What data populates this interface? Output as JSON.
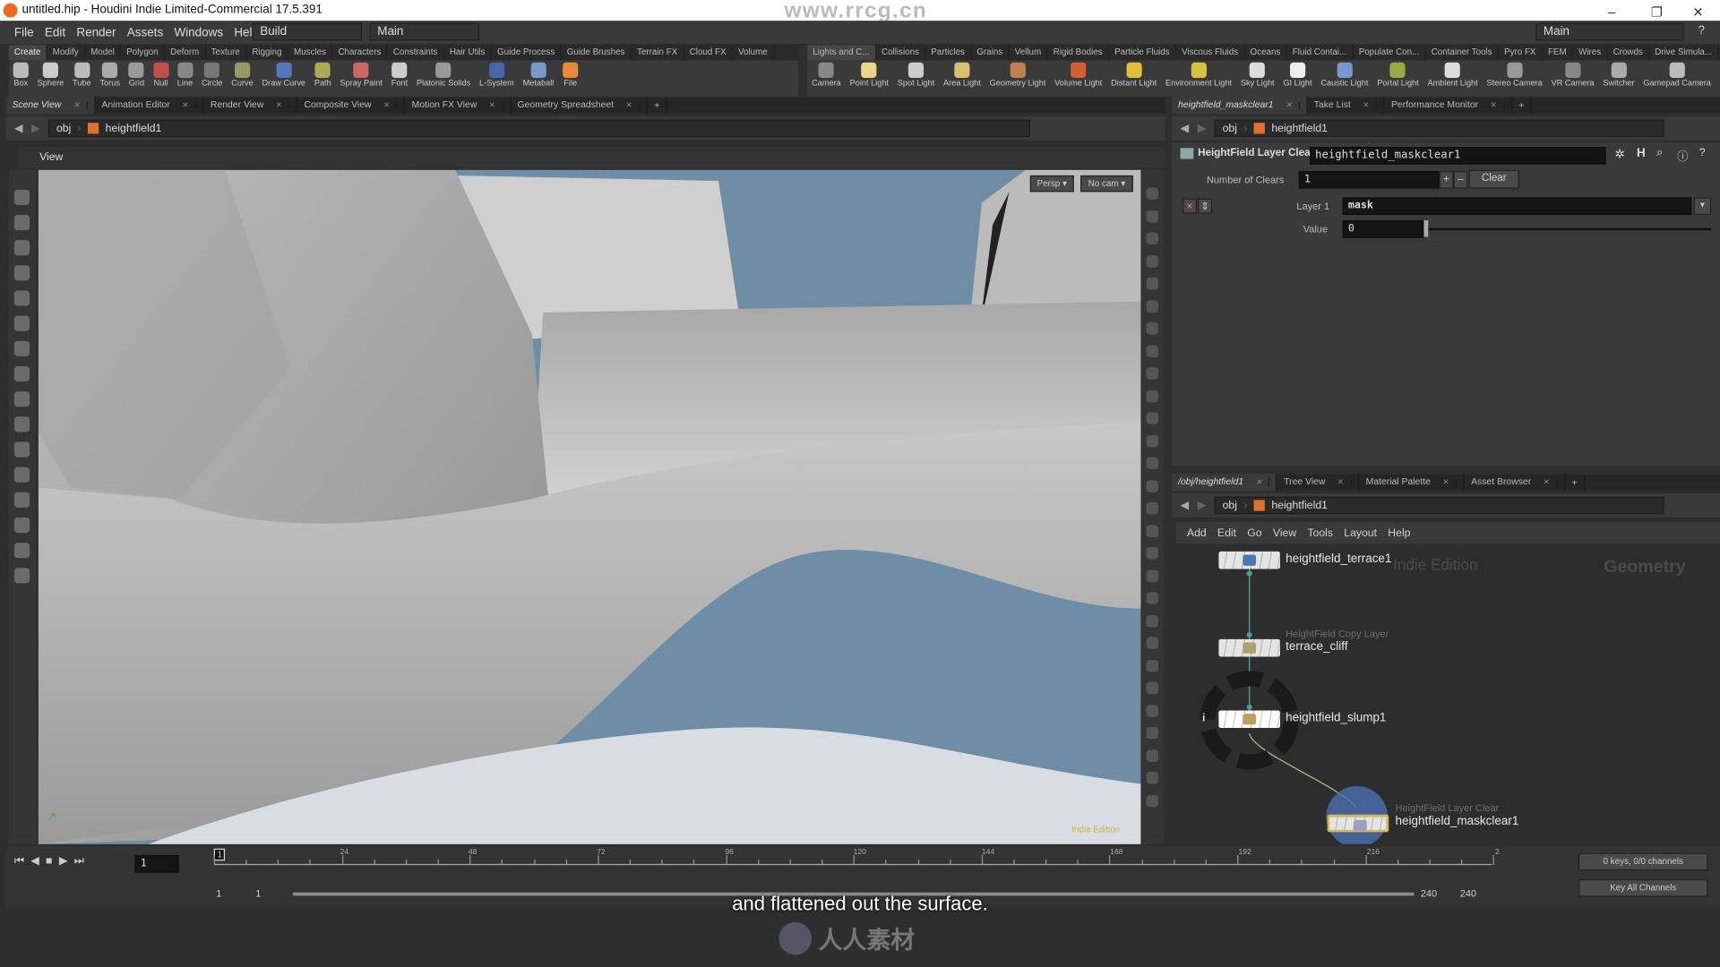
{
  "window": {
    "title": "untitled.hip - Houdini Indie Limited-Commercial 17.5.391",
    "watermark": "www.rrcg.cn",
    "minimize": "–",
    "maximize": "❐",
    "close": "✕"
  },
  "menubar": {
    "items": [
      "File",
      "Edit",
      "Render",
      "Assets",
      "Windows",
      "Help"
    ],
    "desktop": "Build",
    "context": "Main",
    "right_desktop": "Main",
    "help": "?"
  },
  "shelf_left": {
    "tabs": [
      "Create",
      "Modify",
      "Model",
      "Polygon",
      "Deform",
      "Texture",
      "Rigging",
      "Muscles",
      "Characters",
      "Constraints",
      "Hair Utils",
      "Guide Process",
      "Guide Brushes",
      "Terrain FX",
      "Cloud FX",
      "Volume"
    ],
    "tools": [
      {
        "label": "Box",
        "icon": "box-icon",
        "color": "#bbbbbb"
      },
      {
        "label": "Sphere",
        "icon": "sphere-icon",
        "color": "#cccccc"
      },
      {
        "label": "Tube",
        "icon": "tube-icon",
        "color": "#bbbbbb"
      },
      {
        "label": "Torus",
        "icon": "torus-icon",
        "color": "#aaaaaa"
      },
      {
        "label": "Grid",
        "icon": "grid-icon",
        "color": "#999999"
      },
      {
        "label": "Null",
        "icon": "null-icon",
        "color": "#c0504d"
      },
      {
        "label": "Line",
        "icon": "line-icon",
        "color": "#888888"
      },
      {
        "label": "Circle",
        "icon": "circle-icon",
        "color": "#777777"
      },
      {
        "label": "Curve",
        "icon": "curve-icon",
        "color": "#999966"
      },
      {
        "label": "Draw Curve",
        "icon": "draw-curve-icon",
        "color": "#5577bb"
      },
      {
        "label": "Path",
        "icon": "path-icon",
        "color": "#aaaa55"
      },
      {
        "label": "Spray Paint",
        "icon": "spray-paint-icon",
        "color": "#cc6666"
      },
      {
        "label": "Font",
        "icon": "font-icon",
        "color": "#cccccc"
      },
      {
        "label": "Platonic Solids",
        "icon": "platonic-solids-icon",
        "color": "#999999"
      },
      {
        "label": "L-System",
        "icon": "l-system-icon",
        "color": "#4466aa"
      },
      {
        "label": "Metaball",
        "icon": "metaball-icon",
        "color": "#7799cc"
      },
      {
        "label": "File",
        "icon": "file-icon",
        "color": "#e88a3a"
      }
    ]
  },
  "shelf_right": {
    "tabs": [
      "Lights and C...",
      "Collisions",
      "Particles",
      "Grains",
      "Vellum",
      "Rigid Bodies",
      "Particle Fluids",
      "Viscous Fluids",
      "Oceans",
      "Fluid Contai...",
      "Populate Con...",
      "Container Tools",
      "Pyro FX",
      "FEM",
      "Wires",
      "Crowds",
      "Drive Simula..."
    ],
    "tools": [
      {
        "label": "Camera",
        "icon": "camera-icon",
        "color": "#888888"
      },
      {
        "label": "Point Light",
        "icon": "point-light-icon",
        "color": "#e8d58a"
      },
      {
        "label": "Spot Light",
        "icon": "spot-light-icon",
        "color": "#cccccc"
      },
      {
        "label": "Area Light",
        "icon": "area-light-icon",
        "color": "#d8c070"
      },
      {
        "label": "Geometry Light",
        "icon": "geometry-light-icon",
        "color": "#c08050"
      },
      {
        "label": "Volume Light",
        "icon": "volume-light-icon",
        "color": "#d06030"
      },
      {
        "label": "Distant Light",
        "icon": "distant-light-icon",
        "color": "#e0c040"
      },
      {
        "label": "Environment Light",
        "icon": "environment-light-icon",
        "color": "#d8c040"
      },
      {
        "label": "Sky Light",
        "icon": "sky-light-icon",
        "color": "#dddddd"
      },
      {
        "label": "GI Light",
        "icon": "gi-light-icon",
        "color": "#eeeeee"
      },
      {
        "label": "Caustic Light",
        "icon": "caustic-light-icon",
        "color": "#7799cc"
      },
      {
        "label": "Portal Light",
        "icon": "portal-light-icon",
        "color": "#99aa44"
      },
      {
        "label": "Ambient Light",
        "icon": "ambient-light-icon",
        "color": "#dddddd"
      },
      {
        "label": "Stereo Camera",
        "icon": "stereo-camera-icon",
        "color": "#999999"
      },
      {
        "label": "VR Camera",
        "icon": "vr-camera-icon",
        "color": "#888888"
      },
      {
        "label": "Switcher",
        "icon": "switcher-icon",
        "color": "#aaaaaa"
      },
      {
        "label": "Gamepad Camera",
        "icon": "gamepad-camera-icon",
        "color": "#bbbbbb"
      }
    ]
  },
  "left_pane": {
    "tabs": [
      "Scene View",
      "Animation Editor",
      "Render View",
      "Composite View",
      "Motion FX View",
      "Geometry Spreadsheet"
    ],
    "path": [
      "obj",
      "heightfield1"
    ],
    "view_label": "View",
    "persp": "Persp ▾",
    "cam": "No cam ▾",
    "edition": "Indie Edition"
  },
  "params_pane": {
    "tabs": [
      "heightfield_maskclear1",
      "Take List",
      "Performance Monitor"
    ],
    "path": [
      "obj",
      "heightfield1"
    ],
    "node_type": "HeightField Layer Clear",
    "node_name": "heightfield_maskclear1",
    "num_clears_label": "Number of Clears",
    "num_clears": "1",
    "plus": "+",
    "minus": "–",
    "clear_button": "Clear",
    "layer_label": "Layer 1",
    "layer_value": "mask",
    "value_label": "Value",
    "value": "0"
  },
  "network_pane": {
    "tabs": [
      "/obj/heightfield1",
      "Tree View",
      "Material Palette",
      "Asset Browser"
    ],
    "path": [
      "obj",
      "heightfield1"
    ],
    "menu": [
      "Add",
      "Edit",
      "Go",
      "View",
      "Tools",
      "Layout",
      "Help"
    ],
    "edition": "Indie Edition",
    "context": "Geometry",
    "nodes": [
      {
        "name": "heightfield_terrace1",
        "type": ""
      },
      {
        "name": "terrace_cliff",
        "type": "HeightField Copy Layer"
      },
      {
        "name": "heightfield_slump1",
        "type": ""
      },
      {
        "name": "heightfield_maskclear1",
        "type": "HeightField Layer Clear"
      }
    ]
  },
  "timeline": {
    "current_frame": "1",
    "frame_marker": "1",
    "ticks": [
      "24",
      "48",
      "72",
      "96",
      "120",
      "144",
      "168",
      "192",
      "216",
      "2"
    ],
    "range_start": "1",
    "range_start2": "1",
    "range_end": "240",
    "range_end2": "240",
    "keys": "0 keys, 0/0 channels",
    "key_all": "Key All Channels"
  },
  "subtitle": "and flattened out the surface.",
  "logo_text": "人人素材"
}
